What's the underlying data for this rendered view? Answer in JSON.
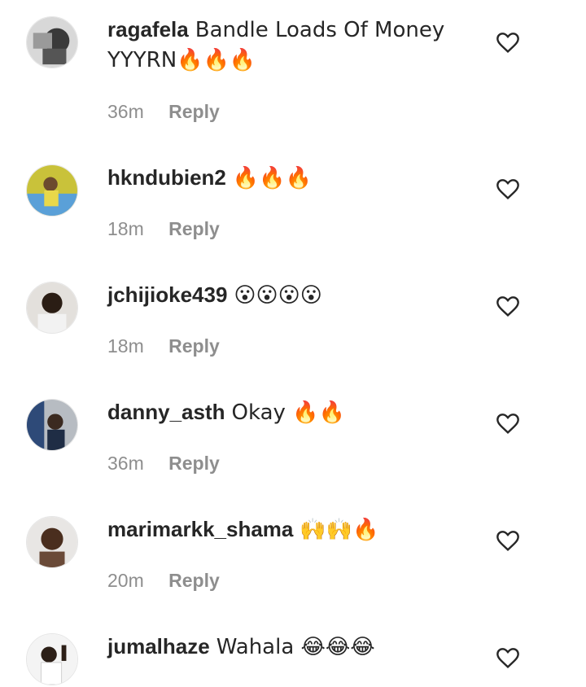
{
  "reply_label": "Reply",
  "comments": [
    {
      "username": "ragafela",
      "text": "Bandle Loads Of Money YYYRN🔥🔥🔥",
      "time": "36m"
    },
    {
      "username": "hkndubien2",
      "text": "🔥🔥🔥",
      "time": "18m"
    },
    {
      "username": "jchijioke439",
      "text": "😮😮😮😮",
      "time": "18m"
    },
    {
      "username": "danny_asth",
      "text": "Okay 🔥🔥",
      "time": "36m"
    },
    {
      "username": "marimarkk_shama",
      "text": "🙌🙌🔥",
      "time": "20m"
    },
    {
      "username": "jumalhaze",
      "text": "Wahala 😂😂😂",
      "time": ""
    }
  ]
}
